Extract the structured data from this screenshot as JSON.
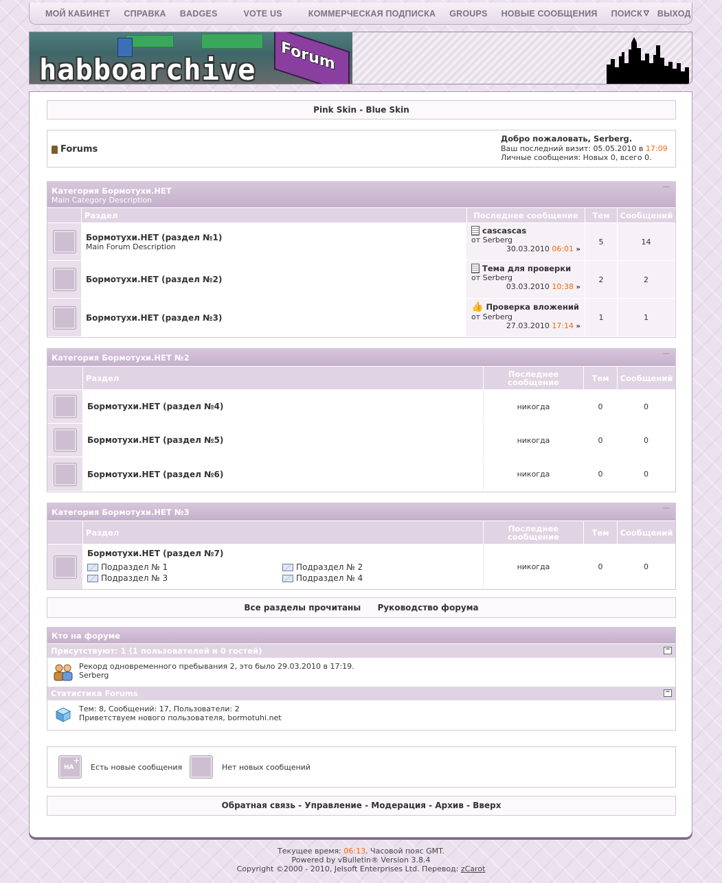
{
  "nav": [
    "Мой кабинет",
    "Справка",
    "Badges",
    "Vote Us",
    "Коммерческая подписка",
    "Groups",
    "Новые сообщения",
    "Поиск",
    "Выход"
  ],
  "logo": {
    "text": "habboarchive",
    "badge": "Forum"
  },
  "style_links": {
    "pink": "Pink Skin",
    "sep": "-",
    "blue": "Blue Skin"
  },
  "breadcrumb": {
    "title": "Forums"
  },
  "welcome": {
    "greeting": "Добро пожаловать, Serberg.",
    "last_visit_prefix": "Ваш последний визит: 05.05.2010 в",
    "last_visit_time": "17:09",
    "pm": "Личные сообщения: Новых 0, всего 0."
  },
  "columns": {
    "forum": "Раздел",
    "last_post": "Последнее сообщение",
    "threads": "Тем",
    "posts": "Сообщений"
  },
  "categories": [
    {
      "title": "Категория Бормотухи.НЕТ",
      "desc": "Main Category Description",
      "forums": [
        {
          "title": "Бормотухи.НЕТ (раздел №1)",
          "desc": "Main Forum Description",
          "last_title": "cascascas",
          "last_by": "от Serberg",
          "last_date": "30.03.2010",
          "last_time": "06:01",
          "threads": "5",
          "posts": "14"
        },
        {
          "title": "Бормотухи.НЕТ (раздел №2)",
          "desc": "",
          "last_title": "Тема для проверки",
          "last_by": "от Serberg",
          "last_date": "03.03.2010",
          "last_time": "10:38",
          "threads": "2",
          "posts": "2"
        },
        {
          "title": "Бормотухи.НЕТ (раздел №3)",
          "desc": "",
          "last_title": "Проверка вложений",
          "last_by": "от Serberg",
          "last_date": "27.03.2010",
          "last_time": "17:14",
          "threads": "1",
          "posts": "1"
        }
      ]
    },
    {
      "title": "Категория Бормотухи.НЕТ №2",
      "forums": [
        {
          "title": "Бормотухи.НЕТ (раздел №4)",
          "last": "никогда",
          "threads": "0",
          "posts": "0"
        },
        {
          "title": "Бормотухи.НЕТ (раздел №5)",
          "last": "никогда",
          "threads": "0",
          "posts": "0"
        },
        {
          "title": "Бормотухи.НЕТ (раздел №6)",
          "last": "никогда",
          "threads": "0",
          "posts": "0"
        }
      ]
    },
    {
      "title": "Категория Бормотухи.НЕТ №3",
      "forums": [
        {
          "title": "Бормотухи.НЕТ (раздел №7)",
          "last": "никогда",
          "threads": "0",
          "posts": "0",
          "subforums": [
            "Подраздел № 1",
            "Подраздел № 2",
            "Подраздел № 3",
            "Подраздел № 4"
          ]
        }
      ]
    }
  ],
  "forum_links": {
    "mark_read": "Все разделы прочитаны",
    "guide": "Руководство форума"
  },
  "whos_online": {
    "title": "Кто на форуме",
    "present": "Присутствуют: 1 (1 пользователей и 0 гостей)",
    "record": "Рекорд одновременного пребывания 2, это было 29.03.2010 в 17:19.",
    "users": "Serberg",
    "stats_title": "Статистика Forums",
    "stats": "Тем: 8, Сообщений: 17, Пользователи: 2",
    "welcome_new": "Приветствуем нового пользователя, bormotuhi.net"
  },
  "legend": {
    "new": "Есть новые сообщения",
    "no_new": "Нет новых сообщений",
    "icon_text": "НА"
  },
  "footer_links": [
    "Обратная связь",
    "Управление",
    "Модерация",
    "Архив",
    "Вверх"
  ],
  "footer": {
    "time_prefix": "Текущее время:",
    "time": "06:13",
    "time_suffix": ". Часовой пояс GMT.",
    "powered": "Powered by vBulletin® Version 3.8.4",
    "copyright": "Copyright ©2000 - 2010, Jelsoft Enterprises Ltd. Перевод:",
    "translator": "zCarot"
  },
  "colors": {
    "accent_orange": "#ff6600",
    "header_purple": "#c4b0ca",
    "page_bg": "#ece2ef"
  }
}
